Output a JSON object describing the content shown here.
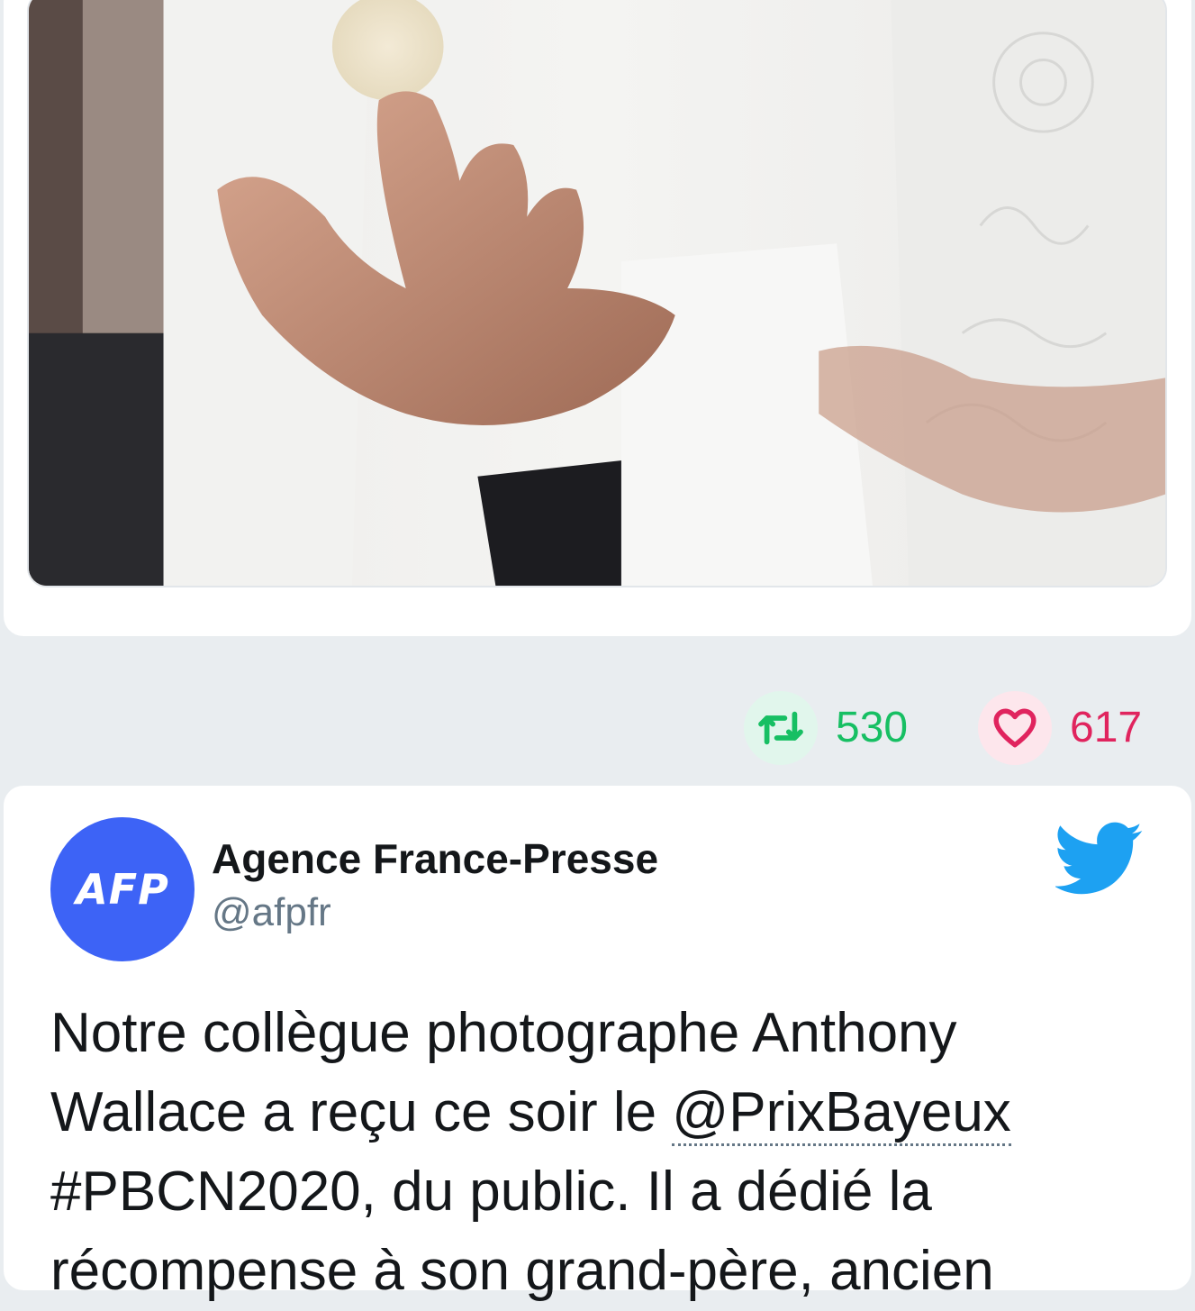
{
  "tweet_top": {
    "retweets": "530",
    "likes": "617",
    "retweet_icon": "retweet-icon",
    "like_icon": "heart-icon"
  },
  "tweet": {
    "author_name": "Agence France-Presse",
    "handle": "@afpfr",
    "avatar_text": "AFP",
    "text_part1": "Notre collègue photographe Anthony Wallace a reçu ce soir le ",
    "mention": "@PrixBayeux",
    "text_part2": " #PBCN2020, du public. Il a dédié la récompense à son grand-père, ancien",
    "logo_icon": "twitter-bird-icon"
  },
  "colors": {
    "background": "#e9edf0",
    "retweet_green": "#17bf63",
    "like_red": "#e0245e",
    "twitter_blue": "#1da1f2",
    "afp_blue": "#3d63f6"
  }
}
